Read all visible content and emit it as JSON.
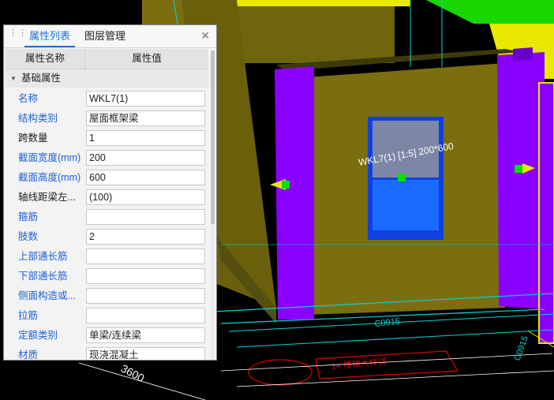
{
  "panel": {
    "tabs": [
      {
        "label": "属性列表",
        "active": true
      },
      {
        "label": "图层管理",
        "active": false
      }
    ],
    "close_icon": "close-icon",
    "columns": {
      "name": "属性名称",
      "value": "属性值"
    },
    "group": {
      "label": "基础属性",
      "expanded": true
    },
    "rows": [
      {
        "name": "名称",
        "value": "WKL7(1)",
        "name_color": "blue"
      },
      {
        "name": "结构类别",
        "value": "屋面框架梁",
        "name_color": "blue"
      },
      {
        "name": "跨数量",
        "value": "1",
        "name_color": "black"
      },
      {
        "name": "截面宽度(mm)",
        "value": "200",
        "name_color": "blue"
      },
      {
        "name": "截面高度(mm)",
        "value": "600",
        "name_color": "blue"
      },
      {
        "name": "轴线距梁左...",
        "value": "(100)",
        "name_color": "black"
      },
      {
        "name": "箍筋",
        "value": "",
        "name_color": "blue"
      },
      {
        "name": "肢数",
        "value": "2",
        "name_color": "blue"
      },
      {
        "name": "上部通长筋",
        "value": "",
        "name_color": "blue"
      },
      {
        "name": "下部通长筋",
        "value": "",
        "name_color": "blue"
      },
      {
        "name": "侧面构造或...",
        "value": "",
        "name_color": "blue"
      },
      {
        "name": "拉筋",
        "value": "",
        "name_color": "blue"
      },
      {
        "name": "定额类别",
        "value": "单梁/连续梁",
        "name_color": "blue"
      },
      {
        "name": "材质",
        "value": "现浇混凝土",
        "name_color": "blue"
      }
    ]
  },
  "viewport": {
    "beam_label": "WKL7(1) [1:5] 200*600",
    "window_label": "C0915",
    "axis_dim": "3600",
    "stair_label": "1# 楼梯大样详",
    "colors": {
      "wall": "#7a6e10",
      "wall_top": "#5a5208",
      "column": "#8a00ff",
      "cyan_line": "#00d5d5",
      "yellow": "#e8e800",
      "green": "#00e000",
      "window": "#1a5cff"
    }
  }
}
